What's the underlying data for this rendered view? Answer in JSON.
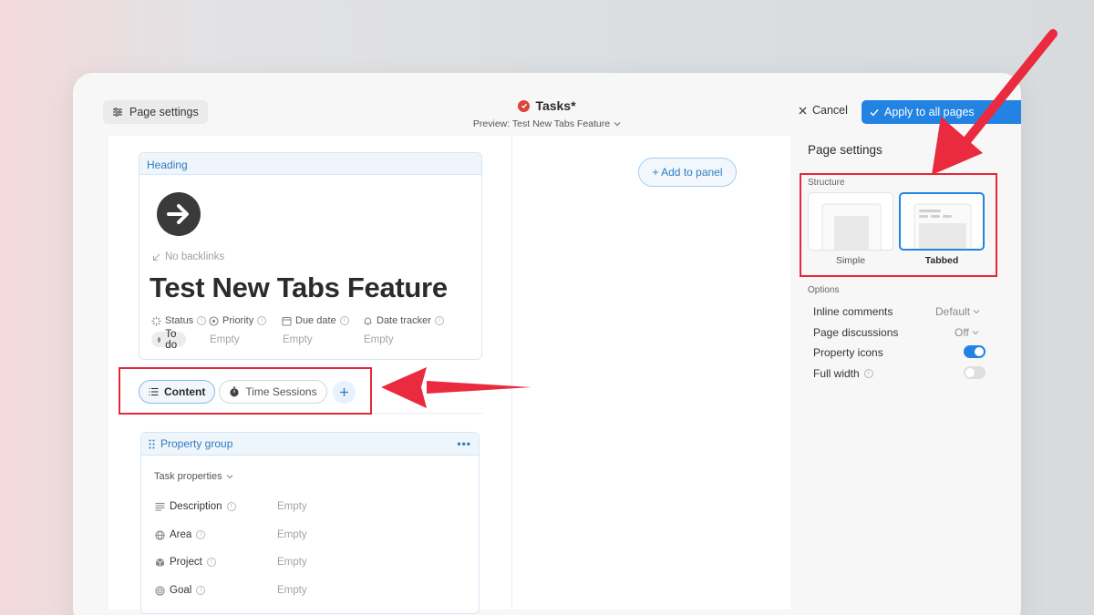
{
  "header": {
    "page_settings_label": "Page settings",
    "title": "Tasks*",
    "preview": "Preview: Test New Tabs Feature",
    "cancel_label": "Cancel",
    "apply_label": "Apply to all pages"
  },
  "page": {
    "heading_block_label": "Heading",
    "backlinks_text": "No backlinks",
    "title": "Test New Tabs Feature",
    "properties": [
      {
        "label": "Status",
        "value": "To do"
      },
      {
        "label": "Priority",
        "value": "Empty"
      },
      {
        "label": "Due date",
        "value": "Empty"
      },
      {
        "label": "Date tracker",
        "value": "Empty"
      }
    ]
  },
  "tabs": [
    {
      "label": "Content",
      "active": true
    },
    {
      "label": "Time Sessions",
      "active": false
    }
  ],
  "property_group": {
    "title": "Property group",
    "menu": "•••",
    "subtitle": "Task properties",
    "fields": [
      {
        "label": "Description",
        "value": "Empty"
      },
      {
        "label": "Area",
        "value": "Empty"
      },
      {
        "label": "Project",
        "value": "Empty"
      },
      {
        "label": "Goal",
        "value": "Empty"
      }
    ]
  },
  "add_panel_label": "+ Add to panel",
  "settings_panel": {
    "title": "Page settings",
    "structure_label": "Structure",
    "structure_options": [
      {
        "label": "Simple",
        "selected": false
      },
      {
        "label": "Tabbed",
        "selected": true
      }
    ],
    "options_label": "Options",
    "options": [
      {
        "label": "Inline comments",
        "value": "Default",
        "type": "select"
      },
      {
        "label": "Page discussions",
        "value": "Off",
        "type": "select"
      },
      {
        "label": "Property icons",
        "state": true,
        "type": "toggle"
      },
      {
        "label": "Full width",
        "state": false,
        "type": "toggle"
      }
    ]
  },
  "colors": {
    "accent": "#2383e2",
    "annotation": "#e5273a",
    "status_badge": "#d9453b"
  }
}
